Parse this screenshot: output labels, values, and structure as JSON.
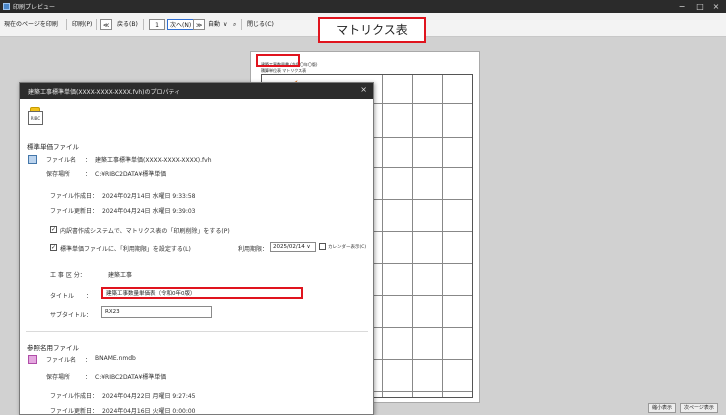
{
  "window": {
    "title": "印刷プレビュー",
    "min": "−",
    "max": "□",
    "close": "×"
  },
  "toolbar": {
    "print_current": "現在のページを印刷",
    "print": "印刷(P)",
    "first": "≪",
    "back": "戻る(B)",
    "page": "1",
    "next": "次へ(N)",
    "last": "≫",
    "zoom": "自動",
    "zoom_caret": "∨",
    "close": "閉じる(C)"
  },
  "callout": "マトリクス表",
  "paper": {
    "header": "建築工事数量書 (令和〇年〇版)",
    "subheader": "積算単位表 マトリクス表"
  },
  "dialog": {
    "title": "建築工事標準単価(XXXX-XXXX-XXXX.fvh)のプロパティ",
    "close": "×",
    "icon_text": "RIBC",
    "std_section": "標準単価ファイル",
    "file_name_label": "ファイル名",
    "file_name_value": "建築工事標準単価(XXXX-XXXX-XXXX).fvh",
    "location_label": "保存場所",
    "location_value": "C:¥RIBC2DATA¥標準単価",
    "created_label": "ファイル作成日：",
    "created_value": "2024年02月14日 水曜日 9:33:58",
    "updated_label": "ファイル更新日：",
    "updated_value": "2024年04月24日 水曜日 9:39:03",
    "check1": "内訳書作成システムで、マトリクス表の「印刷削除」をする(P)",
    "check2": "標準単価ファイルに、「利用期限」を設定する(L)",
    "expiry_label": "利用期限：",
    "expiry_value": "2025/02/14",
    "calendar_label": "カレンダー表示(C)",
    "work_type_label": "工 事 区 分：",
    "work_type_value": "建築工事",
    "title_label": "タイトル",
    "title_value": "建築工事数量単価表（令和0年0版）",
    "subtitle_label": "サブタイトル：",
    "subtitle_value": "RX23",
    "ref_section": "参照名用ファイル",
    "ref_file_label": "ファイル名",
    "ref_file_value": "BNAME.nmdb",
    "ref_location_label": "保存場所",
    "ref_location_value": "C:¥RIBC2DATA¥標準単価",
    "ref_created_label": "ファイル作成日：",
    "ref_created_value": "2024年04月22日 月曜日 9:27:45",
    "ref_updated_label": "ファイル更新日：",
    "ref_updated_value": "2024年04月16日 火曜日 0:00:00"
  },
  "statusbar": {
    "zoom1": "縮小表示",
    "zoom2": "次ページ表示"
  },
  "colors": {
    "accent_red": "#e0141e",
    "arrow_fill": "#f2c49a",
    "arrow_stroke": "#e07a2c"
  }
}
